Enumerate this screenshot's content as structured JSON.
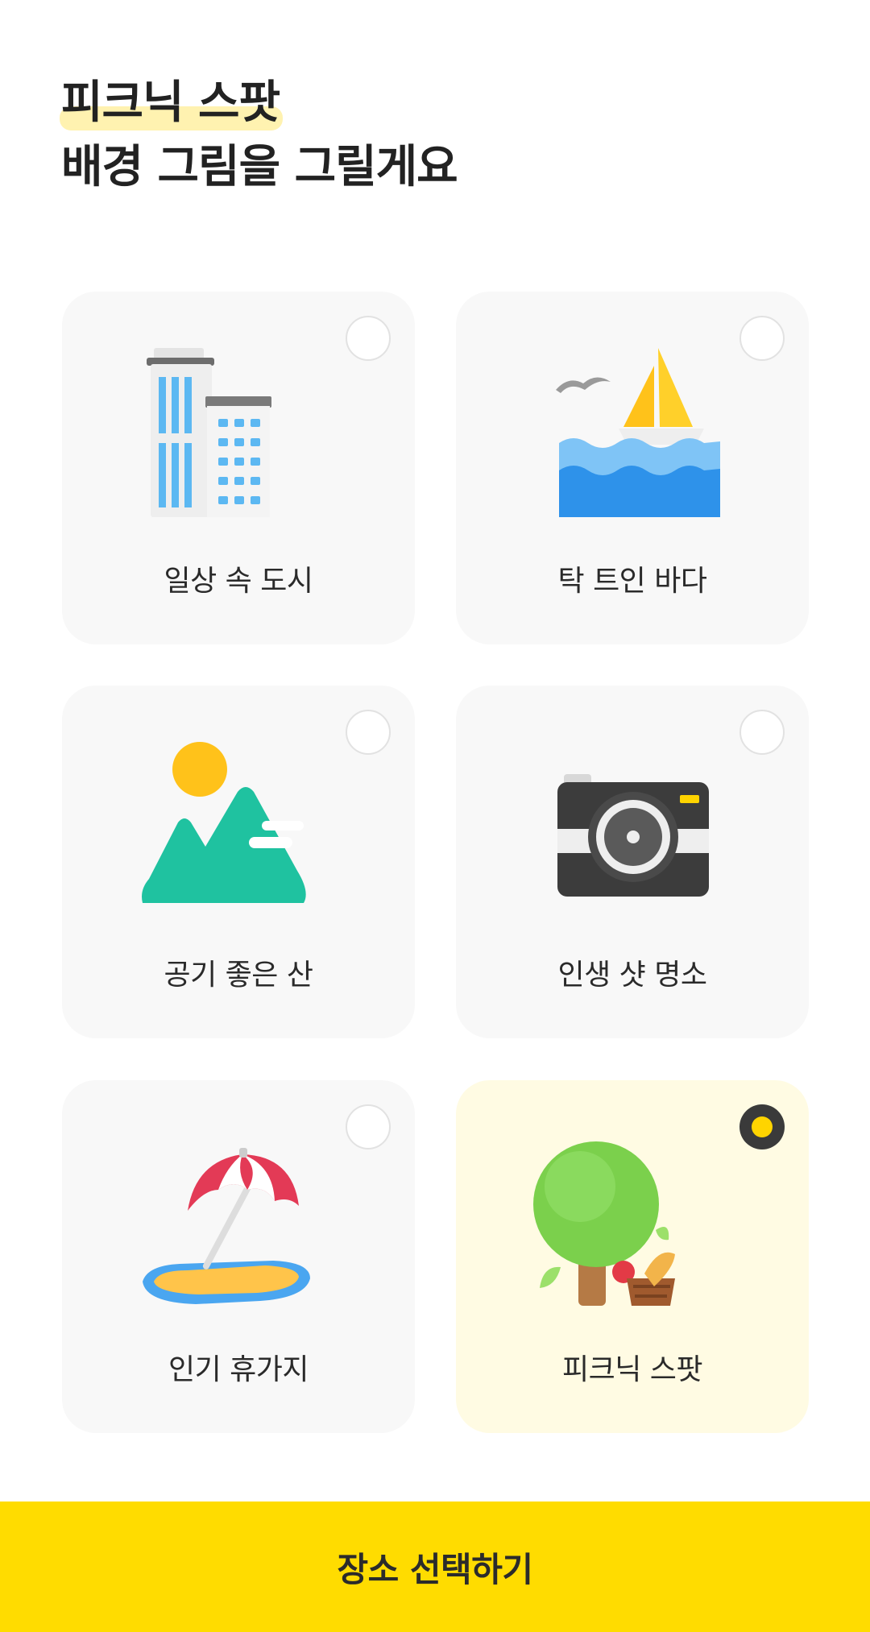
{
  "header": {
    "title_highlight": "피크닉 스팟",
    "title_rest": "배경 그림을 그릴게요"
  },
  "options": [
    {
      "label": "일상 속 도시",
      "icon": "city-buildings-icon",
      "selected": false
    },
    {
      "label": "탁 트인 바다",
      "icon": "sailboat-sea-icon",
      "selected": false
    },
    {
      "label": "공기 좋은 산",
      "icon": "mountain-sun-icon",
      "selected": false
    },
    {
      "label": "인생 샷 명소",
      "icon": "camera-icon",
      "selected": false
    },
    {
      "label": "인기 휴가지",
      "icon": "beach-umbrella-icon",
      "selected": false
    },
    {
      "label": "피크닉 스팟",
      "icon": "tree-picnic-basket-icon",
      "selected": true
    }
  ],
  "cta": {
    "label": "장소 선택하기"
  },
  "colors": {
    "accent": "#ffdc00",
    "card_bg": "#f8f8f8",
    "card_selected_bg": "#fffbe3",
    "title_highlight": "#fff2b0",
    "radio_selected": "#3a3a3a"
  }
}
